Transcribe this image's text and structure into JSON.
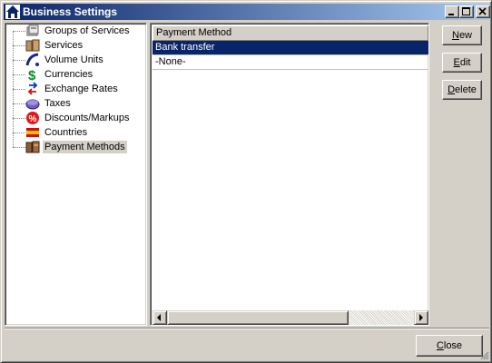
{
  "window": {
    "title": "Business Settings",
    "icon": "home-icon"
  },
  "titlebar_buttons": [
    "minimize-icon",
    "maximize-icon",
    "close-icon"
  ],
  "tree": {
    "items": [
      {
        "label": "Groups of Services",
        "icon": "folder-group-icon",
        "selected": false
      },
      {
        "label": "Services",
        "icon": "services-icon",
        "selected": false
      },
      {
        "label": "Volume Units",
        "icon": "volume-icon",
        "selected": false
      },
      {
        "label": "Currencies",
        "icon": "dollar-icon",
        "selected": false
      },
      {
        "label": "Exchange Rates",
        "icon": "exchange-arrows-icon",
        "selected": false
      },
      {
        "label": "Taxes",
        "icon": "taxes-icon",
        "selected": false
      },
      {
        "label": "Discounts/Markups",
        "icon": "discount-icon",
        "selected": false
      },
      {
        "label": "Countries",
        "icon": "flag-icon",
        "selected": false
      },
      {
        "label": "Payment Methods",
        "icon": "payment-icon",
        "selected": true
      }
    ]
  },
  "list": {
    "column_header": "Payment Method",
    "rows": [
      {
        "label": "Bank transfer",
        "selected": true
      },
      {
        "label": "-None-",
        "selected": false
      }
    ]
  },
  "buttons": {
    "new": {
      "pre": "",
      "mnemonic": "N",
      "post": "ew"
    },
    "edit": {
      "pre": "",
      "mnemonic": "E",
      "post": "dit"
    },
    "delete": {
      "pre": "",
      "mnemonic": "D",
      "post": "elete"
    },
    "close": {
      "pre": "",
      "mnemonic": "C",
      "post": "lose"
    }
  },
  "colors": {
    "selection": "#0a246a",
    "face": "#d4d0c8",
    "title_gradient_start": "#0a246a",
    "title_gradient_end": "#a6caf0"
  }
}
